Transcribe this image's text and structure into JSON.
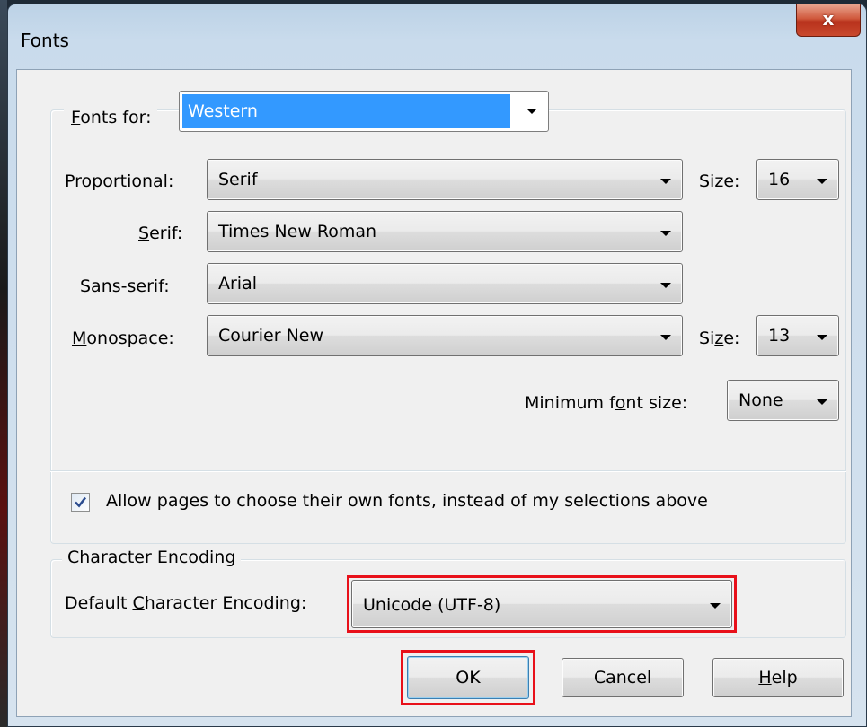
{
  "window": {
    "title": "Fonts",
    "close_glyph": "x"
  },
  "fonts_for": {
    "label": "Fonts for:",
    "value": "Western"
  },
  "rows": [
    {
      "label": "Proportional:",
      "value": "Serif"
    },
    {
      "label": "Serif:",
      "value": "Times New Roman"
    },
    {
      "label": "Sans-serif:",
      "value": "Arial"
    },
    {
      "label": "Monospace:",
      "value": "Courier New"
    }
  ],
  "proportional_size": {
    "label": "Size:",
    "value": "16"
  },
  "monospace_size": {
    "label": "Size:",
    "value": "13"
  },
  "minimum_font_size": {
    "label": "Minimum font size:",
    "value": "None"
  },
  "allow_pages": {
    "label": "Allow pages to choose their own fonts, instead of my selections above",
    "checked": true
  },
  "encoding": {
    "group_title": "Character Encoding",
    "label": "Default Character Encoding:",
    "value": "Unicode (UTF-8)"
  },
  "buttons": {
    "ok": "OK",
    "cancel": "Cancel",
    "help": "Help"
  },
  "colors": {
    "highlight": "#e8101a",
    "selection": "#3399ff"
  }
}
